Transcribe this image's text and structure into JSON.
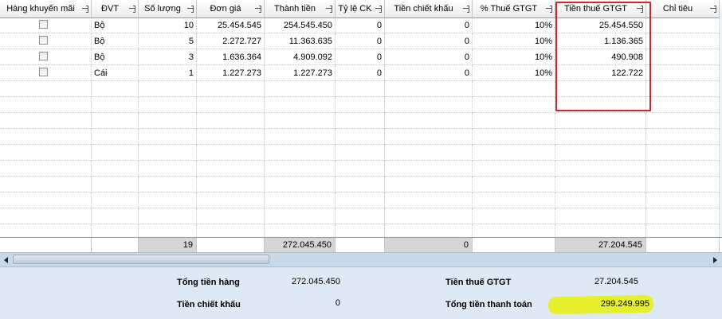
{
  "columns": [
    {
      "key": "promo",
      "label": "Hàng khuyến mãi"
    },
    {
      "key": "unit",
      "label": "ĐVT"
    },
    {
      "key": "qty",
      "label": "Số lượng"
    },
    {
      "key": "price",
      "label": "Đơn giá"
    },
    {
      "key": "amount",
      "label": "Thành tiền"
    },
    {
      "key": "disc_rate",
      "label": "Tỷ lệ CK"
    },
    {
      "key": "disc_amount",
      "label": "Tiền chiết khấu"
    },
    {
      "key": "vat_rate",
      "label": "% Thuế GTGT"
    },
    {
      "key": "vat_amount",
      "label": "Tiền thuế GTGT"
    },
    {
      "key": "target",
      "label": "Chỉ tiêu"
    }
  ],
  "rows": [
    {
      "promo": false,
      "unit": "Bộ",
      "qty": "10",
      "price": "25.454.545",
      "amount": "254.545.450",
      "disc_rate": "0",
      "disc_amount": "0",
      "vat_rate": "10%",
      "vat_amount": "25.454.550",
      "target": ""
    },
    {
      "promo": false,
      "unit": "Bộ",
      "qty": "5",
      "price": "2.272.727",
      "amount": "11.363.635",
      "disc_rate": "0",
      "disc_amount": "0",
      "vat_rate": "10%",
      "vat_amount": "1.136.365",
      "target": ""
    },
    {
      "promo": false,
      "unit": "Bộ",
      "qty": "3",
      "price": "1.636.364",
      "amount": "4.909.092",
      "disc_rate": "0",
      "disc_amount": "0",
      "vat_rate": "10%",
      "vat_amount": "490.908",
      "target": ""
    },
    {
      "promo": false,
      "unit": "Cái",
      "qty": "1",
      "price": "1.227.273",
      "amount": "1.227.273",
      "disc_rate": "0",
      "disc_amount": "0",
      "vat_rate": "10%",
      "vat_amount": "122.722",
      "target": ""
    }
  ],
  "footer": {
    "qty": "19",
    "amount": "272.045.450",
    "disc_amount": "0",
    "vat_amount": "27.204.545"
  },
  "summary": {
    "goods_total_label": "Tổng tiền hàng",
    "goods_total_value": "272.045.450",
    "discount_label": "Tiền chiết khấu",
    "discount_value": "0",
    "vat_label": "Tiền thuế GTGT",
    "vat_value": "27.204.545",
    "payment_total_label": "Tổng tiền thanh toán",
    "payment_total_value": "299.249.995"
  },
  "icons": {
    "pin": "pin-icon",
    "scroll_left": "scroll-left-arrow-icon",
    "scroll_right": "scroll-right-arrow-icon",
    "checkbox": "checkbox"
  },
  "colors": {
    "highlight": "#e6ef2c",
    "annotation_box": "#c8282f",
    "summary_bg": "#dfe9f5",
    "footer_sum_bg": "#d6d6d6"
  }
}
